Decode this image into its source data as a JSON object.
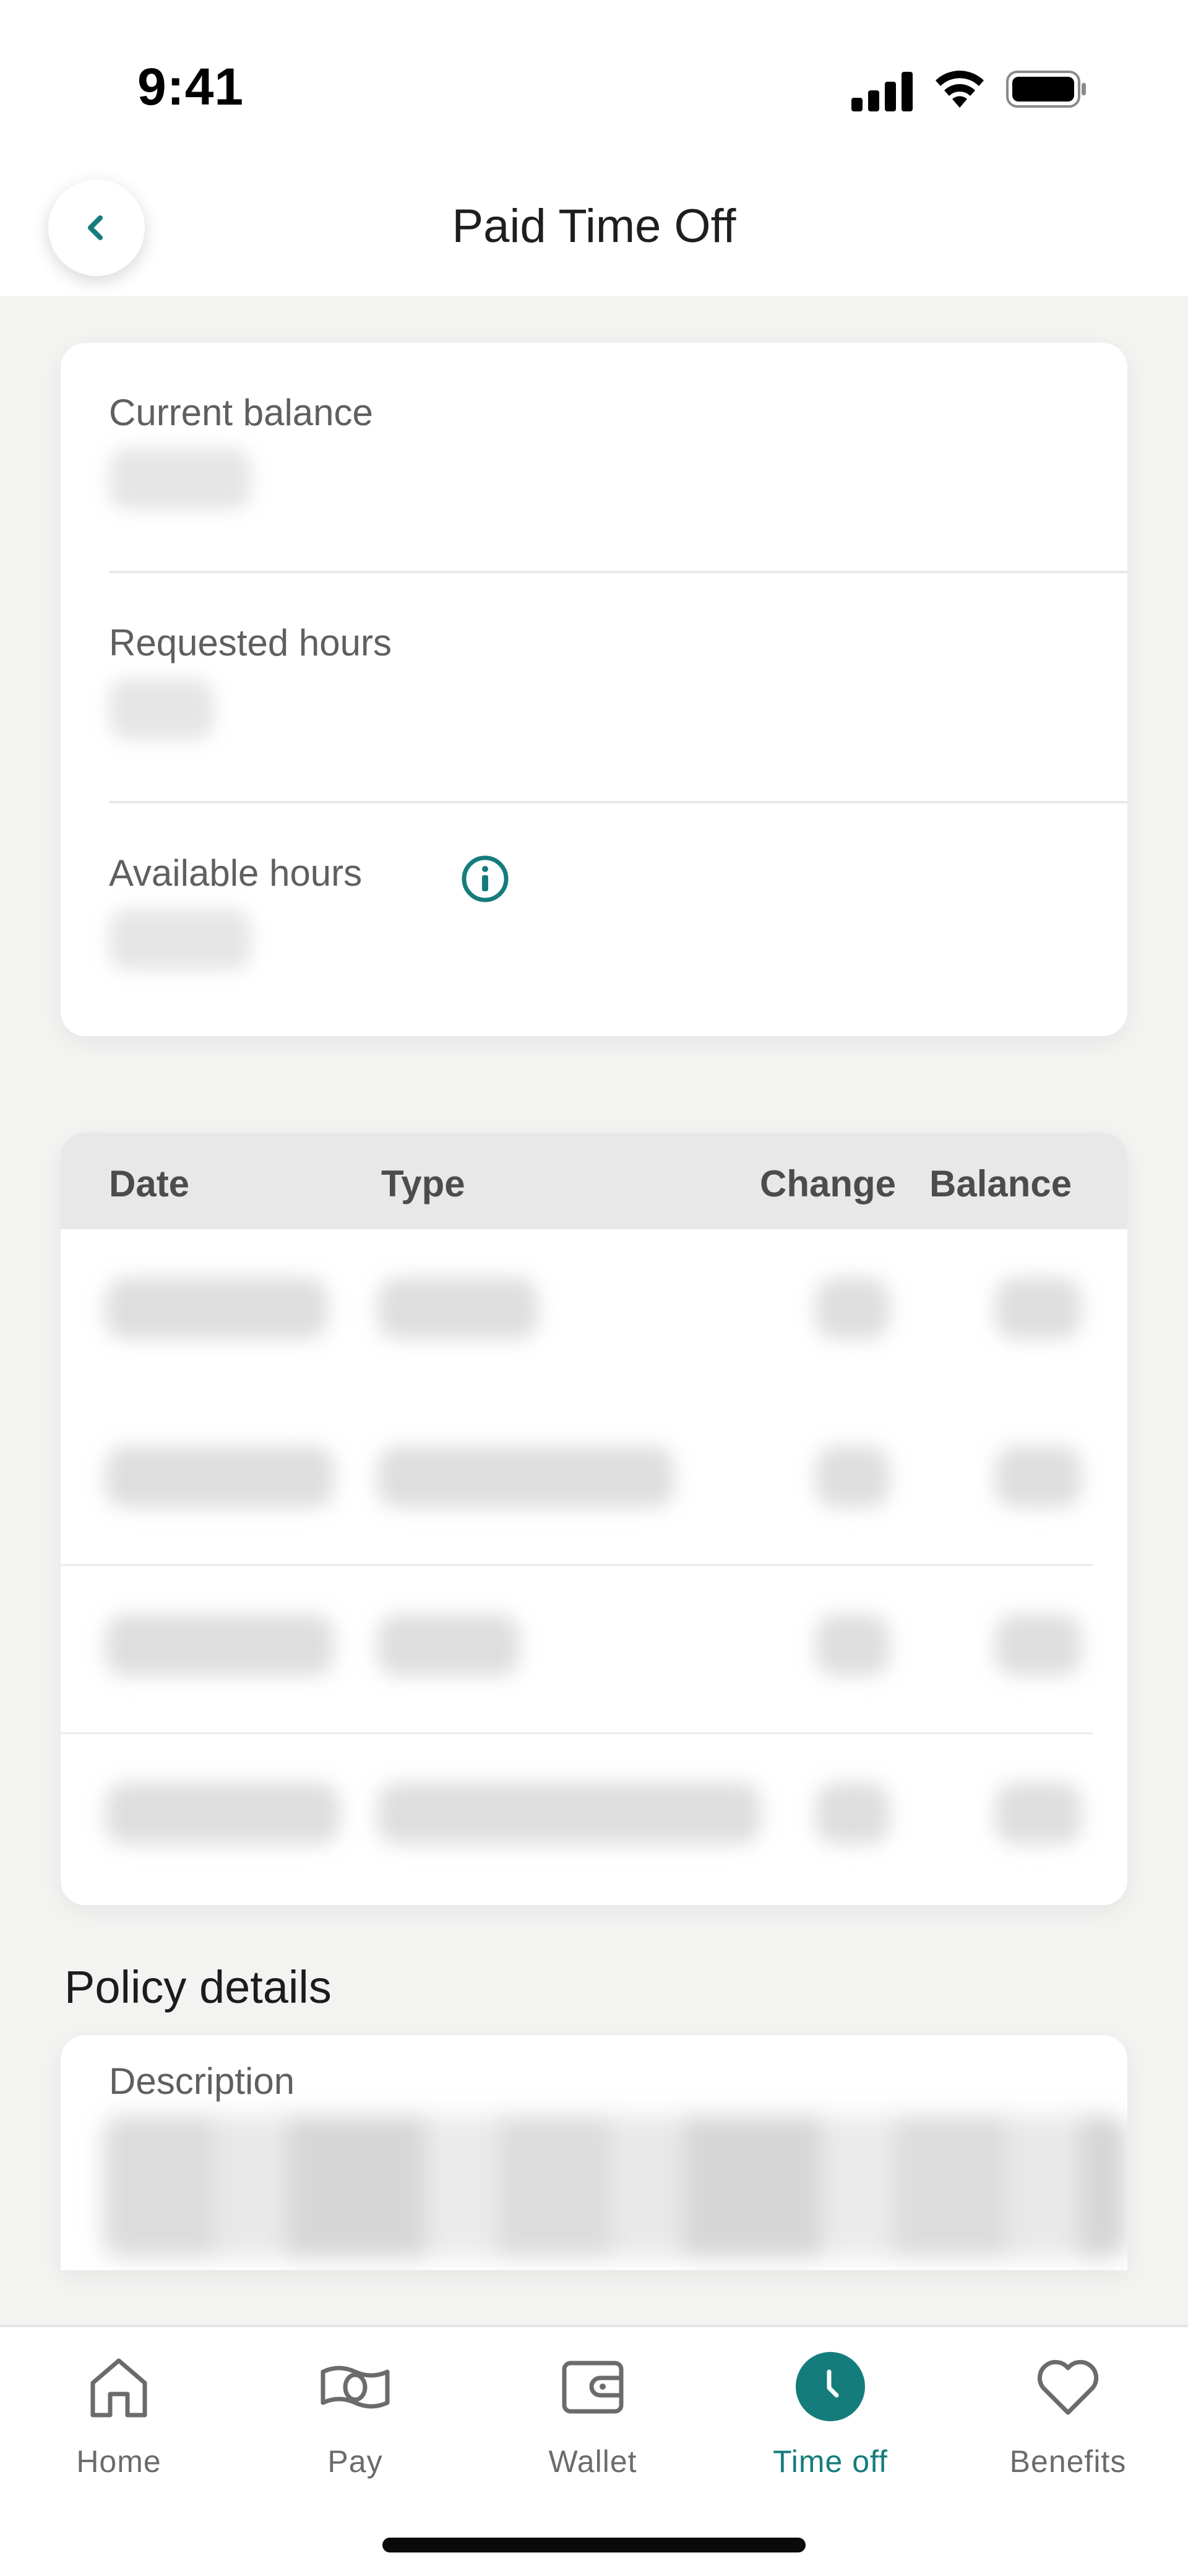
{
  "status_bar": {
    "time": "9:41",
    "icons": [
      "cellular-signal-icon",
      "wifi-icon",
      "battery-icon"
    ]
  },
  "header": {
    "title": "Paid Time Off",
    "back_icon": "chevron-left-icon"
  },
  "balances": {
    "current_label": "Current balance",
    "current_value": "",
    "requested_label": "Requested hours",
    "requested_value": "",
    "available_label": "Available hours",
    "available_value": "",
    "info_icon": "info-circle-icon"
  },
  "history": {
    "columns": [
      "Date",
      "Type",
      "Change",
      "Balance"
    ],
    "rows": [
      {
        "date": "",
        "type": "",
        "change": "",
        "balance": ""
      },
      {
        "date": "",
        "type": "",
        "change": "",
        "balance": ""
      },
      {
        "date": "",
        "type": "",
        "change": "",
        "balance": ""
      },
      {
        "date": "",
        "type": "",
        "change": "",
        "balance": ""
      }
    ]
  },
  "policy": {
    "section_title": "Policy details",
    "description_label": "Description",
    "description_value": ""
  },
  "tabs": [
    {
      "label": "Home",
      "icon": "home-icon",
      "active": false
    },
    {
      "label": "Pay",
      "icon": "money-icon",
      "active": false
    },
    {
      "label": "Wallet",
      "icon": "wallet-icon",
      "active": false
    },
    {
      "label": "Time off",
      "icon": "clock-icon",
      "active": true
    },
    {
      "label": "Benefits",
      "icon": "heart-icon",
      "active": false
    }
  ],
  "colors": {
    "accent": "#157c7c",
    "background": "#f3f3f2",
    "card": "#ffffff",
    "table_header": "#e8e8e8",
    "tab_inactive": "#6b6b6b"
  }
}
